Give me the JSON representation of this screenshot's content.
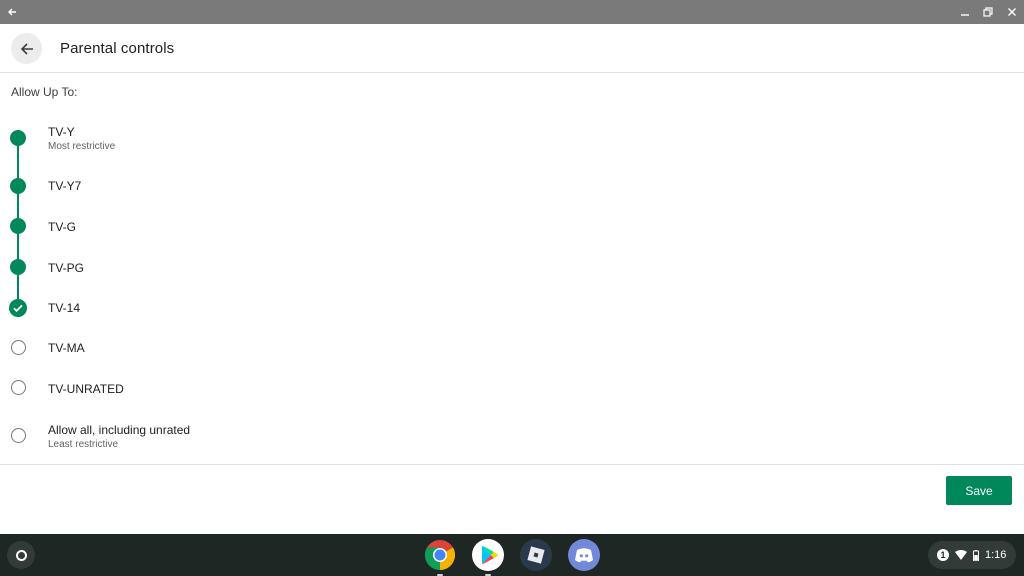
{
  "window": {
    "back_icon": "arrow-left-icon",
    "minimize_icon": "minimize-icon",
    "restore_icon": "restore-icon",
    "close_icon": "close-icon"
  },
  "header": {
    "back_icon": "arrow-back-icon",
    "title": "Parental controls"
  },
  "content": {
    "allow_label": "Allow Up To:",
    "accent_color": "#00875a",
    "ratings": [
      {
        "name": "TV-Y",
        "sub": "Most restrictive",
        "state": "filled"
      },
      {
        "name": "TV-Y7",
        "sub": "",
        "state": "filled"
      },
      {
        "name": "TV-G",
        "sub": "",
        "state": "filled"
      },
      {
        "name": "TV-PG",
        "sub": "",
        "state": "filled"
      },
      {
        "name": "TV-14",
        "sub": "",
        "state": "selected"
      },
      {
        "name": "TV-MA",
        "sub": "",
        "state": "unselected"
      },
      {
        "name": "TV-UNRATED",
        "sub": "",
        "state": "unselected"
      },
      {
        "name": "Allow all, including unrated",
        "sub": "Least restrictive",
        "state": "unselected"
      }
    ],
    "save_label": "Save"
  },
  "shelf": {
    "launcher_icon": "launcher-icon",
    "apps": [
      {
        "name": "chrome-icon"
      },
      {
        "name": "play-store-icon"
      },
      {
        "name": "roblox-icon"
      },
      {
        "name": "discord-icon"
      }
    ],
    "notification_count": "1",
    "wifi_icon": "wifi-icon",
    "battery_icon": "battery-icon",
    "time": "1:16"
  }
}
